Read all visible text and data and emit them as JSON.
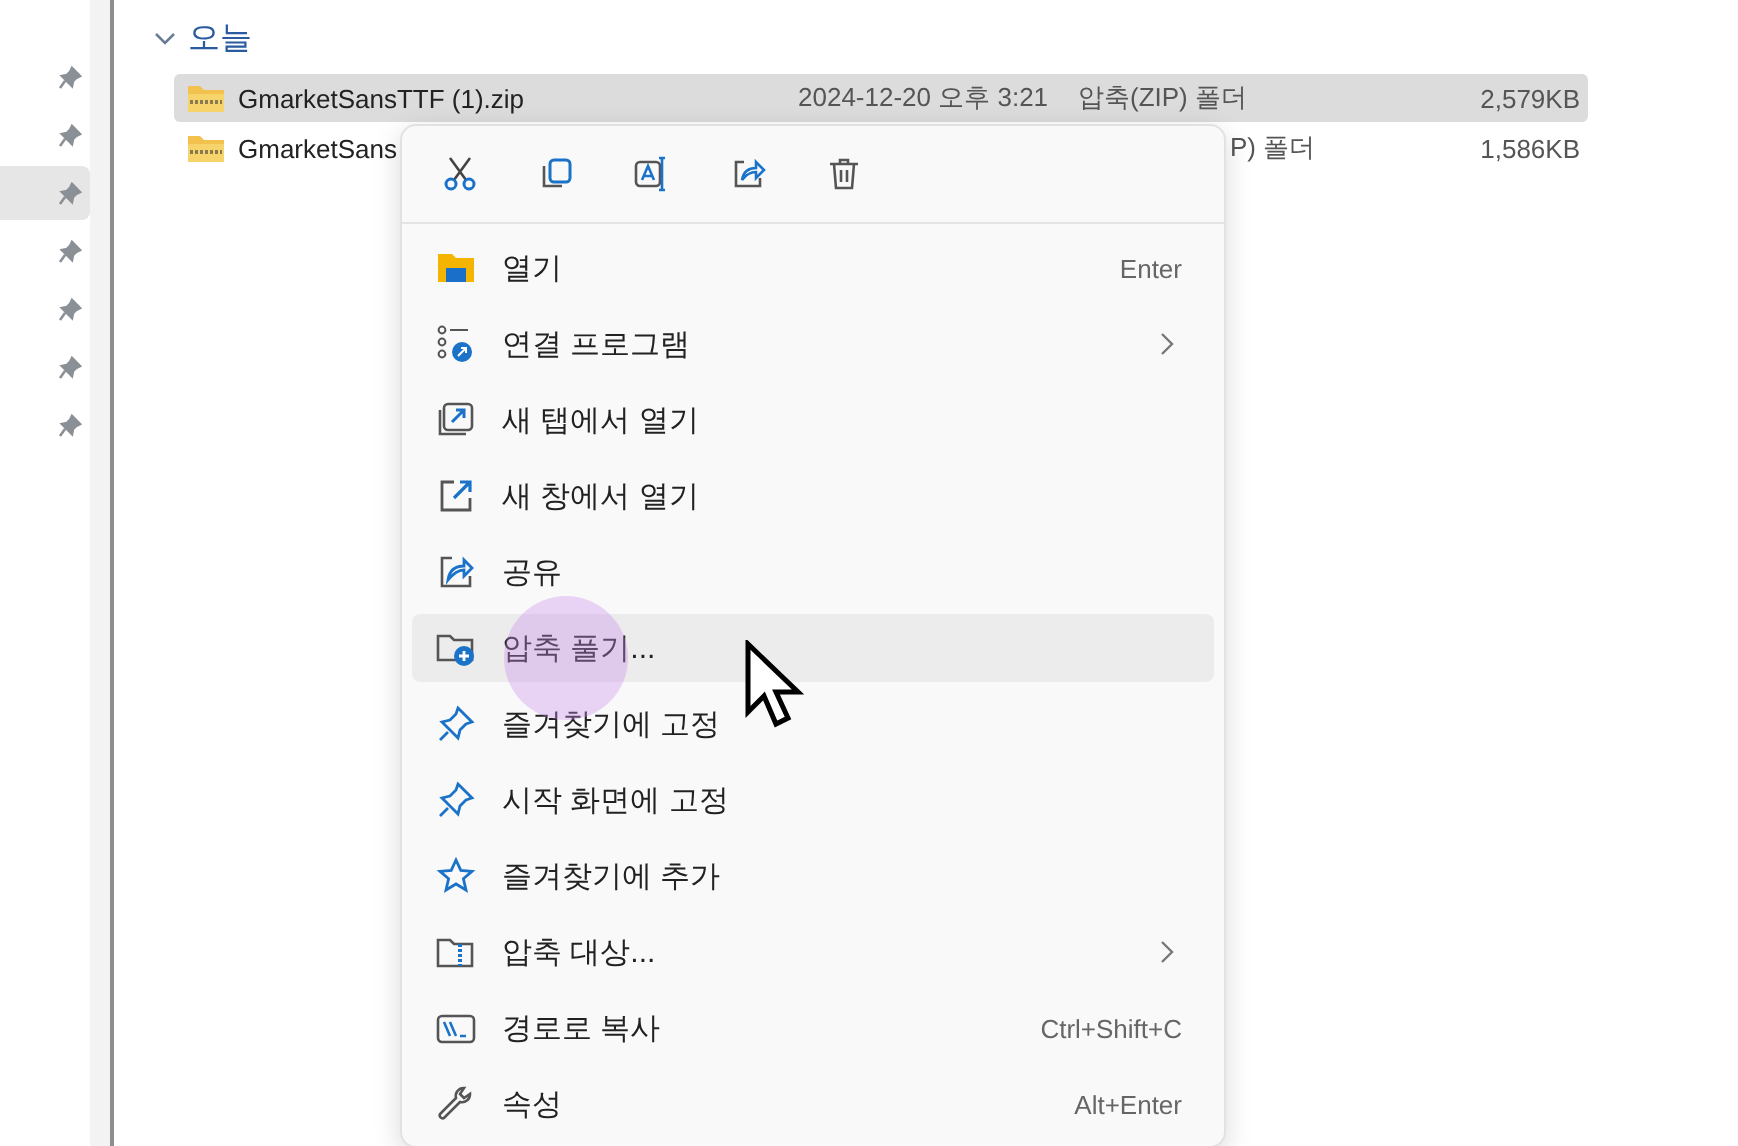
{
  "sidebar": {
    "items": [
      {
        "selected": false
      },
      {
        "selected": false
      },
      {
        "selected": true
      },
      {
        "selected": false
      },
      {
        "selected": false
      },
      {
        "selected": false
      },
      {
        "selected": false
      }
    ]
  },
  "group": {
    "title": "오늘",
    "expanded": true
  },
  "files": [
    {
      "name": "GmarketSansTTF (1).zip",
      "date": "2024-12-20 오후 3:21",
      "type": "압축(ZIP) 폴더",
      "size": "2,579KB",
      "selected": true
    },
    {
      "name": "GmarketSans",
      "type": "P) 폴더",
      "size": "1,586KB",
      "selected": false
    }
  ],
  "context_menu": {
    "items": [
      {
        "label": "열기",
        "shortcut": "Enter",
        "submenu": false,
        "selected": false
      },
      {
        "label": "연결 프로그램",
        "submenu": true,
        "selected": false
      },
      {
        "label": "새 탭에서 열기",
        "submenu": false,
        "selected": false
      },
      {
        "label": "새 창에서 열기",
        "submenu": false,
        "selected": false
      },
      {
        "label": "공유",
        "submenu": false,
        "selected": false
      },
      {
        "label": "압축 풀기...",
        "submenu": false,
        "selected": true
      },
      {
        "label": "즐겨찾기에 고정",
        "submenu": false,
        "selected": false
      },
      {
        "label": "시작 화면에 고정",
        "submenu": false,
        "selected": false
      },
      {
        "label": "즐겨찾기에 추가",
        "submenu": false,
        "selected": false
      },
      {
        "label": "압축 대상...",
        "submenu": true,
        "selected": false
      },
      {
        "label": "경로로 복사",
        "shortcut": "Ctrl+Shift+C",
        "submenu": false,
        "selected": false
      },
      {
        "label": "속성",
        "shortcut": "Alt+Enter",
        "submenu": false,
        "selected": false
      }
    ]
  }
}
